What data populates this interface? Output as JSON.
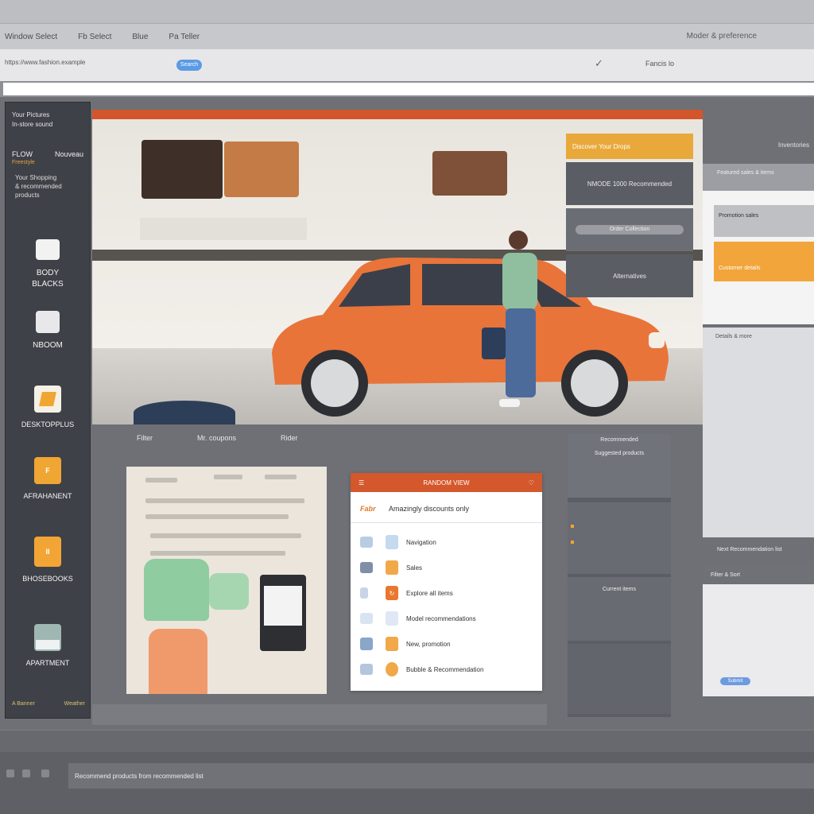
{
  "menubar": {
    "items": [
      "Window Select",
      "Fb Select",
      "Blue",
      "Pa Teller"
    ],
    "right": "Moder & preference"
  },
  "urlbar": {
    "address": "https://www.fashion.example",
    "pill": "Search",
    "user": "Fancis lo"
  },
  "sidebar": {
    "header": "Your Pictures\nIn-store sound",
    "row_left": "FLOW",
    "row_right": "Nouveau",
    "row_sub": "Freestyle",
    "desc": "Your Shopping\n& recommended\nproducts",
    "items": [
      {
        "label": "BODY\nBLACKS",
        "icon": "window-icon",
        "icon_text": ""
      },
      {
        "label": "NBOOM",
        "icon": "window-icon",
        "icon_text": ""
      },
      {
        "label": "DESKTOPPLUS",
        "icon": "folder-icon",
        "icon_text": ""
      },
      {
        "label": "AFRAHANENT",
        "icon": "grid-icon",
        "icon_text": "F"
      },
      {
        "label": "BHOSEBOOKS",
        "icon": "book-icon",
        "icon_text": "II"
      },
      {
        "label": "APARTMENT",
        "icon": "basket-icon",
        "icon_text": ""
      }
    ],
    "footer_left": "A Banner",
    "footer_right": "Weather"
  },
  "hero": {
    "menu_header": "Discover Your Drops",
    "menu_row1": "NMODE 1000 Recommended",
    "menu_row2": "Order Collection",
    "menu_row3": "Alternatives",
    "right_label": "Recommend"
  },
  "filters": [
    "Filter",
    "Mr. coupons",
    "Rider"
  ],
  "popup": {
    "title": "RANDOM VIEW",
    "brand": "Fabr",
    "brand_text": "Amazingly discounts only",
    "items": [
      "Navigation",
      "Sales",
      "Explore all items",
      "Model recommendations",
      "New, promotion",
      "Bubble & Recommendation"
    ]
  },
  "list": {
    "title": "Recommended",
    "sub": "Suggested products",
    "mid": "Current items"
  },
  "rcol": {
    "label": "Inventories",
    "card1": "Featured sales & items",
    "card2": "Promotion sales",
    "card3": "Customer details",
    "card4": "Details & more",
    "caption": "Next Recommendation list",
    "card5": "Filter & Sort",
    "chip": "Submit"
  },
  "bottom": {
    "taskbar_text": "Recommend products from recommended list"
  },
  "colors": {
    "accent": "#d2552c",
    "amber": "#e8a93a",
    "car": "#e8743a"
  }
}
